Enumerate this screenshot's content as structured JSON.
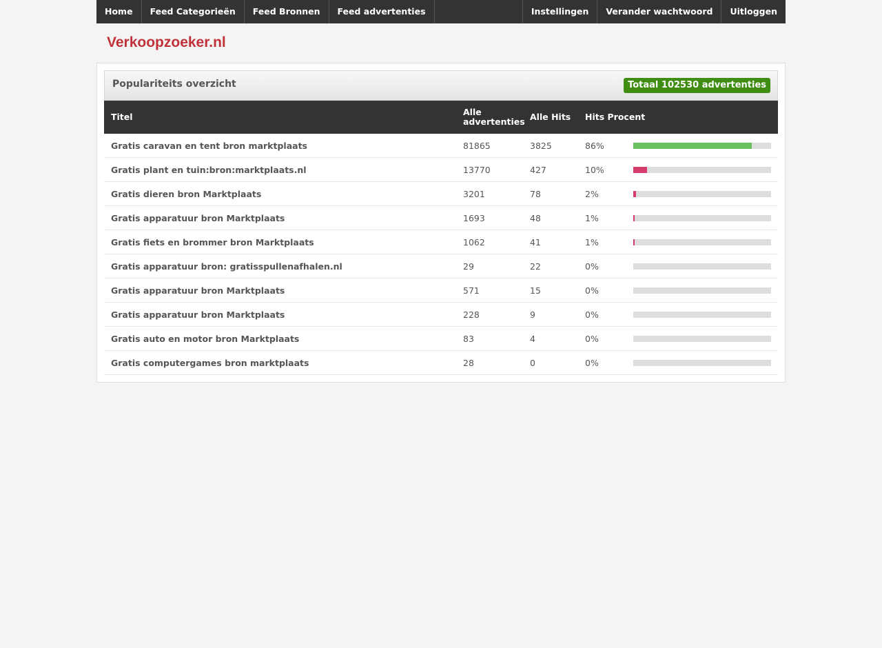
{
  "nav": {
    "left": [
      "Home",
      "Feed Categorieën",
      "Feed Bronnen",
      "Feed advertenties"
    ],
    "right": [
      "Instellingen",
      "Verander wachtwoord",
      "Uitloggen"
    ]
  },
  "brand": "Verkoopzoeker.nl",
  "panel": {
    "title": "Populariteits overzicht",
    "total_badge": "Totaal 102530 advertenties"
  },
  "table": {
    "headers": {
      "title": "Titel",
      "ads_line1": "Alle",
      "ads_line2": "advertenties",
      "hits": "Alle Hits",
      "percent": "Hits Procent"
    },
    "rows": [
      {
        "title": "Gratis caravan en tent bron marktplaats",
        "ads": "81865",
        "hits": "3825",
        "percent": "86%",
        "fraction": 0.86
      },
      {
        "title": "Gratis plant en tuin:bron:marktplaats.nl",
        "ads": "13770",
        "hits": "427",
        "percent": "10%",
        "fraction": 0.1
      },
      {
        "title": "Gratis dieren bron Marktplaats",
        "ads": "3201",
        "hits": "78",
        "percent": "2%",
        "fraction": 0.02
      },
      {
        "title": "Gratis apparatuur bron Marktplaats",
        "ads": "1693",
        "hits": "48",
        "percent": "1%",
        "fraction": 0.01
      },
      {
        "title": "Gratis fiets en brommer bron Marktplaats",
        "ads": "1062",
        "hits": "41",
        "percent": "1%",
        "fraction": 0.01
      },
      {
        "title": "Gratis apparatuur bron: gratisspullenafhalen.nl",
        "ads": "29",
        "hits": "22",
        "percent": "0%",
        "fraction": 0
      },
      {
        "title": "Gratis apparatuur bron Marktplaats",
        "ads": "571",
        "hits": "15",
        "percent": "0%",
        "fraction": 0
      },
      {
        "title": "Gratis apparatuur bron Marktplaats",
        "ads": "228",
        "hits": "9",
        "percent": "0%",
        "fraction": 0
      },
      {
        "title": "Gratis auto en motor bron Marktplaats",
        "ads": "83",
        "hits": "4",
        "percent": "0%",
        "fraction": 0
      },
      {
        "title": "Gratis computergames bron marktplaats",
        "ads": "28",
        "hits": "0",
        "percent": "0%",
        "fraction": 0
      }
    ]
  },
  "colors": {
    "bar_high": "#6abf5e",
    "bar_low": "#d63c6c",
    "bar_track": "#dddddd",
    "badge": "#3f8d12",
    "brand": "#c0313a"
  }
}
